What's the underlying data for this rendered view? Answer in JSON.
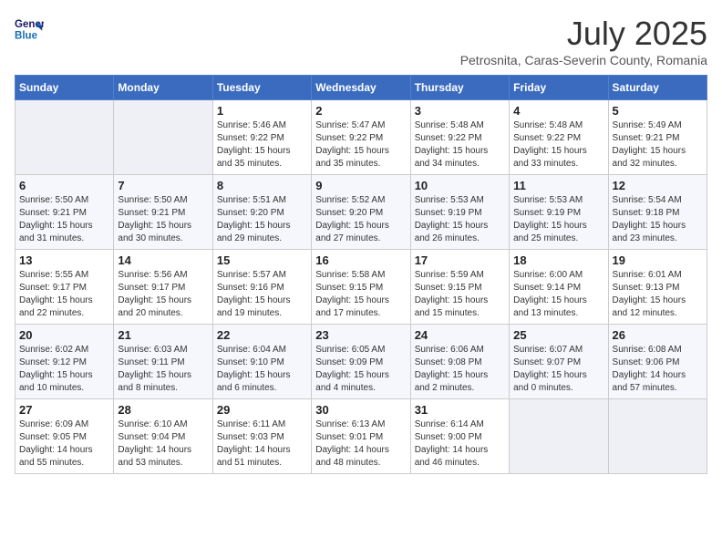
{
  "header": {
    "logo_line1": "General",
    "logo_line2": "Blue",
    "month_title": "July 2025",
    "subtitle": "Petrosnita, Caras-Severin County, Romania"
  },
  "weekdays": [
    "Sunday",
    "Monday",
    "Tuesday",
    "Wednesday",
    "Thursday",
    "Friday",
    "Saturday"
  ],
  "weeks": [
    [
      {
        "day": "",
        "sunrise": "",
        "sunset": "",
        "daylight": ""
      },
      {
        "day": "",
        "sunrise": "",
        "sunset": "",
        "daylight": ""
      },
      {
        "day": "1",
        "sunrise": "Sunrise: 5:46 AM",
        "sunset": "Sunset: 9:22 PM",
        "daylight": "Daylight: 15 hours and 35 minutes."
      },
      {
        "day": "2",
        "sunrise": "Sunrise: 5:47 AM",
        "sunset": "Sunset: 9:22 PM",
        "daylight": "Daylight: 15 hours and 35 minutes."
      },
      {
        "day": "3",
        "sunrise": "Sunrise: 5:48 AM",
        "sunset": "Sunset: 9:22 PM",
        "daylight": "Daylight: 15 hours and 34 minutes."
      },
      {
        "day": "4",
        "sunrise": "Sunrise: 5:48 AM",
        "sunset": "Sunset: 9:22 PM",
        "daylight": "Daylight: 15 hours and 33 minutes."
      },
      {
        "day": "5",
        "sunrise": "Sunrise: 5:49 AM",
        "sunset": "Sunset: 9:21 PM",
        "daylight": "Daylight: 15 hours and 32 minutes."
      }
    ],
    [
      {
        "day": "6",
        "sunrise": "Sunrise: 5:50 AM",
        "sunset": "Sunset: 9:21 PM",
        "daylight": "Daylight: 15 hours and 31 minutes."
      },
      {
        "day": "7",
        "sunrise": "Sunrise: 5:50 AM",
        "sunset": "Sunset: 9:21 PM",
        "daylight": "Daylight: 15 hours and 30 minutes."
      },
      {
        "day": "8",
        "sunrise": "Sunrise: 5:51 AM",
        "sunset": "Sunset: 9:20 PM",
        "daylight": "Daylight: 15 hours and 29 minutes."
      },
      {
        "day": "9",
        "sunrise": "Sunrise: 5:52 AM",
        "sunset": "Sunset: 9:20 PM",
        "daylight": "Daylight: 15 hours and 27 minutes."
      },
      {
        "day": "10",
        "sunrise": "Sunrise: 5:53 AM",
        "sunset": "Sunset: 9:19 PM",
        "daylight": "Daylight: 15 hours and 26 minutes."
      },
      {
        "day": "11",
        "sunrise": "Sunrise: 5:53 AM",
        "sunset": "Sunset: 9:19 PM",
        "daylight": "Daylight: 15 hours and 25 minutes."
      },
      {
        "day": "12",
        "sunrise": "Sunrise: 5:54 AM",
        "sunset": "Sunset: 9:18 PM",
        "daylight": "Daylight: 15 hours and 23 minutes."
      }
    ],
    [
      {
        "day": "13",
        "sunrise": "Sunrise: 5:55 AM",
        "sunset": "Sunset: 9:17 PM",
        "daylight": "Daylight: 15 hours and 22 minutes."
      },
      {
        "day": "14",
        "sunrise": "Sunrise: 5:56 AM",
        "sunset": "Sunset: 9:17 PM",
        "daylight": "Daylight: 15 hours and 20 minutes."
      },
      {
        "day": "15",
        "sunrise": "Sunrise: 5:57 AM",
        "sunset": "Sunset: 9:16 PM",
        "daylight": "Daylight: 15 hours and 19 minutes."
      },
      {
        "day": "16",
        "sunrise": "Sunrise: 5:58 AM",
        "sunset": "Sunset: 9:15 PM",
        "daylight": "Daylight: 15 hours and 17 minutes."
      },
      {
        "day": "17",
        "sunrise": "Sunrise: 5:59 AM",
        "sunset": "Sunset: 9:15 PM",
        "daylight": "Daylight: 15 hours and 15 minutes."
      },
      {
        "day": "18",
        "sunrise": "Sunrise: 6:00 AM",
        "sunset": "Sunset: 9:14 PM",
        "daylight": "Daylight: 15 hours and 13 minutes."
      },
      {
        "day": "19",
        "sunrise": "Sunrise: 6:01 AM",
        "sunset": "Sunset: 9:13 PM",
        "daylight": "Daylight: 15 hours and 12 minutes."
      }
    ],
    [
      {
        "day": "20",
        "sunrise": "Sunrise: 6:02 AM",
        "sunset": "Sunset: 9:12 PM",
        "daylight": "Daylight: 15 hours and 10 minutes."
      },
      {
        "day": "21",
        "sunrise": "Sunrise: 6:03 AM",
        "sunset": "Sunset: 9:11 PM",
        "daylight": "Daylight: 15 hours and 8 minutes."
      },
      {
        "day": "22",
        "sunrise": "Sunrise: 6:04 AM",
        "sunset": "Sunset: 9:10 PM",
        "daylight": "Daylight: 15 hours and 6 minutes."
      },
      {
        "day": "23",
        "sunrise": "Sunrise: 6:05 AM",
        "sunset": "Sunset: 9:09 PM",
        "daylight": "Daylight: 15 hours and 4 minutes."
      },
      {
        "day": "24",
        "sunrise": "Sunrise: 6:06 AM",
        "sunset": "Sunset: 9:08 PM",
        "daylight": "Daylight: 15 hours and 2 minutes."
      },
      {
        "day": "25",
        "sunrise": "Sunrise: 6:07 AM",
        "sunset": "Sunset: 9:07 PM",
        "daylight": "Daylight: 15 hours and 0 minutes."
      },
      {
        "day": "26",
        "sunrise": "Sunrise: 6:08 AM",
        "sunset": "Sunset: 9:06 PM",
        "daylight": "Daylight: 14 hours and 57 minutes."
      }
    ],
    [
      {
        "day": "27",
        "sunrise": "Sunrise: 6:09 AM",
        "sunset": "Sunset: 9:05 PM",
        "daylight": "Daylight: 14 hours and 55 minutes."
      },
      {
        "day": "28",
        "sunrise": "Sunrise: 6:10 AM",
        "sunset": "Sunset: 9:04 PM",
        "daylight": "Daylight: 14 hours and 53 minutes."
      },
      {
        "day": "29",
        "sunrise": "Sunrise: 6:11 AM",
        "sunset": "Sunset: 9:03 PM",
        "daylight": "Daylight: 14 hours and 51 minutes."
      },
      {
        "day": "30",
        "sunrise": "Sunrise: 6:13 AM",
        "sunset": "Sunset: 9:01 PM",
        "daylight": "Daylight: 14 hours and 48 minutes."
      },
      {
        "day": "31",
        "sunrise": "Sunrise: 6:14 AM",
        "sunset": "Sunset: 9:00 PM",
        "daylight": "Daylight: 14 hours and 46 minutes."
      },
      {
        "day": "",
        "sunrise": "",
        "sunset": "",
        "daylight": ""
      },
      {
        "day": "",
        "sunrise": "",
        "sunset": "",
        "daylight": ""
      }
    ]
  ]
}
